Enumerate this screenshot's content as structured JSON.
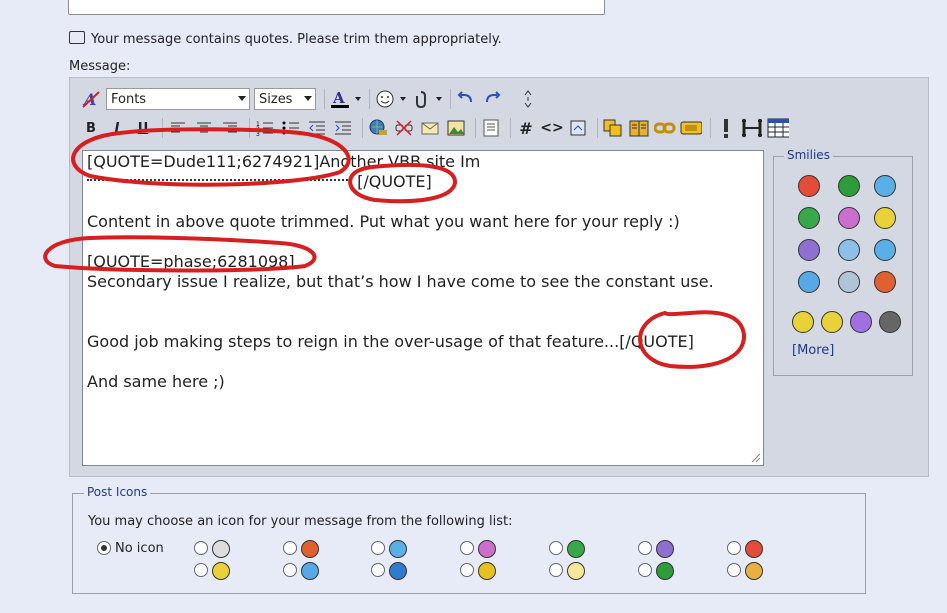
{
  "notice": {
    "text": "Your message contains quotes. Please trim them appropriately."
  },
  "message_label": "Message:",
  "toolbar": {
    "fonts_select": "Fonts",
    "sizes_select": "Sizes",
    "bold": "B",
    "italic": "I",
    "underline": "U",
    "hash": "#",
    "code": "<>"
  },
  "editor": {
    "lines": [
      "[QUOTE=Dude111;6274921]Another VBB site Im",
      "[/QUOTE]",
      "Content in above quote trimmed. Put what you want here for your reply :)",
      "[QUOTE=phase;6281098]",
      "Secondary issue I realize, but that’s how I have come to see the constant use.",
      "Good job making steps to reign in the over-usage of that feature.",
      "..[/QUOTE]",
      "And same here ;)"
    ]
  },
  "smilies": {
    "title": "Smilies",
    "more": "[More]",
    "colors": [
      "#e34b3b",
      "#2f9c3a",
      "#5ab0e6",
      "#38a848",
      "#cc6fcc",
      "#e8d237",
      "#8f6fd0",
      "#8cc0e8",
      "#5ab0e6",
      "#56a8e6",
      "#b0c4d8",
      "#e06030",
      "#e8d237",
      "#e8d237",
      "#a070e0",
      "#666666"
    ]
  },
  "post_icons": {
    "title": "Post Icons",
    "description": "You may choose an icon for your message from the following list:",
    "no_icon_label": "No icon",
    "icon_colors": [
      "#dddddd",
      "#e06030",
      "#5ab0e6",
      "#cc6fcc",
      "#38a848",
      "#8f6fd0",
      "#e34b3b",
      "#e8d237",
      "#56a8e6",
      "#2f7bd0",
      "#e8c020",
      "#f5e89a",
      "#2f9c3a",
      "#e8b040"
    ]
  }
}
